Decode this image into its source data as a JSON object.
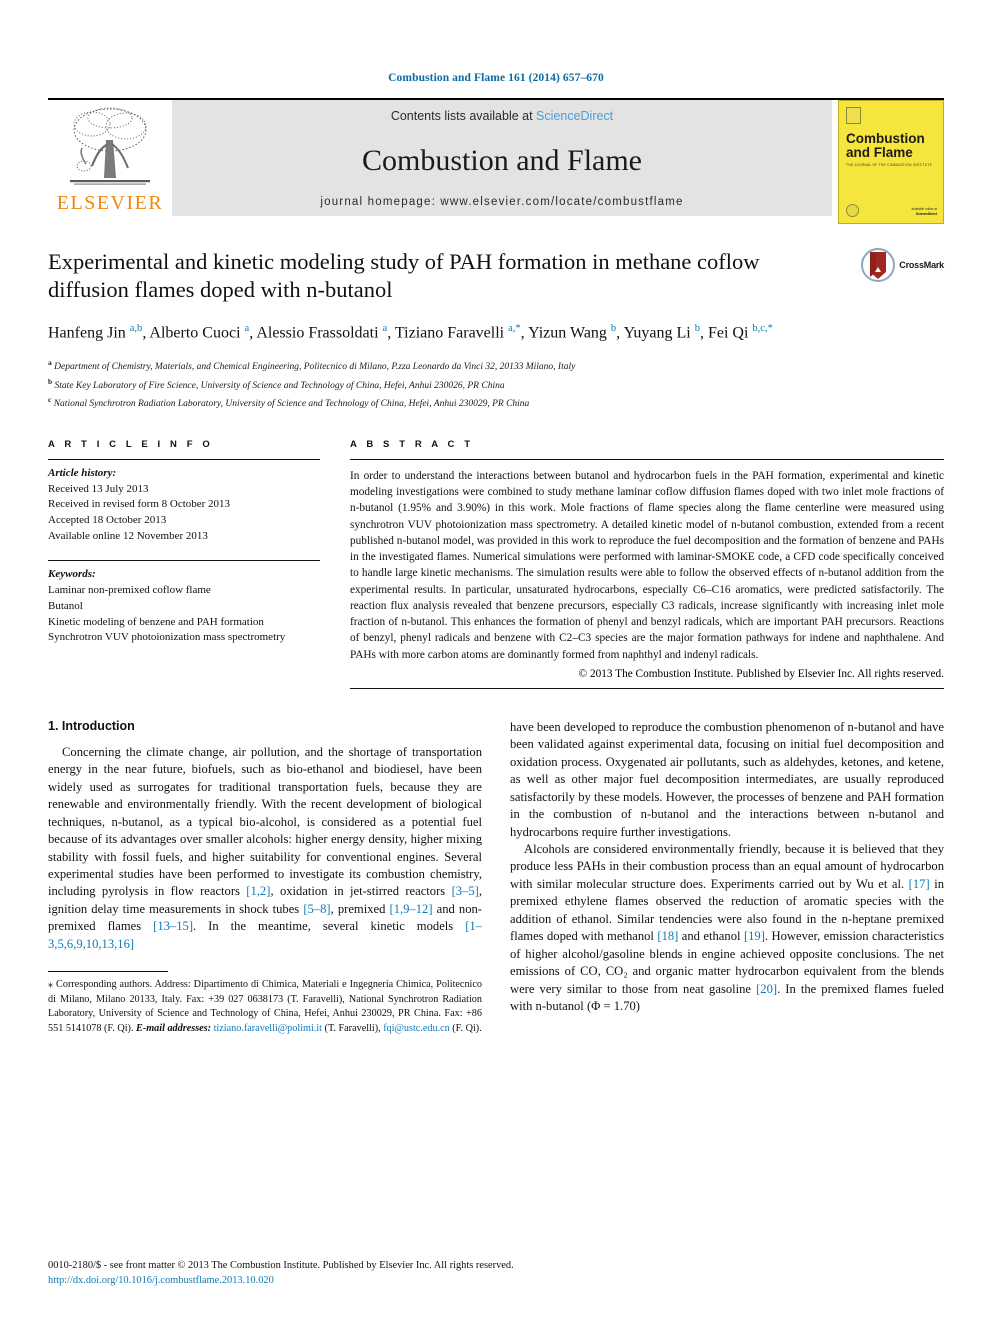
{
  "running_head": "Combustion and Flame 161 (2014) 657–670",
  "masthead": {
    "publisher_logo_label": "ELSEVIER",
    "contents_prefix": "Contents lists available at ",
    "contents_link": "ScienceDirect",
    "journal_title": "Combustion and Flame",
    "homepage_label": "journal homepage: www.elsevier.com/locate/combustflame",
    "cover": {
      "title_line1": "Combustion",
      "title_line2": "and Flame",
      "subtitle": "THE JOURNAL OF THE COMBUSTION INSTITUTE",
      "footer_line1": "available online at",
      "footer_line2": "ScienceDirect"
    },
    "cover_color": "#f5e53c",
    "link_color": "#4a9fd4",
    "band_color": "#e3e3e3"
  },
  "article": {
    "title": "Experimental and kinetic modeling study of PAH formation in methane coflow diffusion flames doped with n-butanol",
    "crossmark_label": "CrossMark",
    "authors_html": "Hanfeng Jin <sup>a,b</sup>, Alberto Cuoci <sup>a</sup>, Alessio Frassoldati <sup>a</sup>, Tiziano Faravelli <sup>a,*</sup>, Yizun Wang <sup>b</sup>, Yuyang Li <sup>b</sup>, Fei Qi <sup>b,c,*</sup>",
    "affiliations": [
      "Department of Chemistry, Materials, and Chemical Engineering, Politecnico di Milano, P.zza Leonardo da Vinci 32, 20133 Milano, Italy",
      "State Key Laboratory of Fire Science, University of Science and Technology of China, Hefei, Anhui 230026, PR China",
      "National Synchrotron Radiation Laboratory, University of Science and Technology of China, Hefei, Anhui 230029, PR China"
    ],
    "affiliation_marks": [
      "a",
      "b",
      "c"
    ]
  },
  "article_info": {
    "heading": "A R T I C L E   I N F O",
    "history_label": "Article history:",
    "history": [
      "Received 13 July 2013",
      "Received in revised form 8 October 2013",
      "Accepted 18 October 2013",
      "Available online 12 November 2013"
    ],
    "keywords_label": "Keywords:",
    "keywords": [
      "Laminar non-premixed coflow flame",
      "Butanol",
      "Kinetic modeling of benzene and PAH formation",
      "Synchrotron VUV photoionization mass spectrometry"
    ]
  },
  "abstract": {
    "heading": "A B S T R A C T",
    "text": "In order to understand the interactions between butanol and hydrocarbon fuels in the PAH formation, experimental and kinetic modeling investigations were combined to study methane laminar coflow diffusion flames doped with two inlet mole fractions of n-butanol (1.95% and 3.90%) in this work. Mole fractions of flame species along the flame centerline were measured using synchrotron VUV photoionization mass spectrometry. A detailed kinetic model of n-butanol combustion, extended from a recent published n-butanol model, was provided in this work to reproduce the fuel decomposition and the formation of benzene and PAHs in the investigated flames. Numerical simulations were performed with laminar-SMOKE code, a CFD code specifically conceived to handle large kinetic mechanisms. The simulation results were able to follow the observed effects of n-butanol addition from the experimental results. In particular, unsaturated hydrocarbons, especially C6–C16 aromatics, were predicted satisfactorily. The reaction flux analysis revealed that benzene precursors, especially C3 radicals, increase significantly with increasing inlet mole fraction of n-butanol. This enhances the formation of phenyl and benzyl radicals, which are important PAH precursors. Reactions of benzyl, phenyl radicals and benzene with C2–C3 species are the major formation pathways for indene and naphthalene. And PAHs with more carbon atoms are dominantly formed from naphthyl and indenyl radicals.",
    "copyright": "© 2013 The Combustion Institute. Published by Elsevier Inc. All rights reserved."
  },
  "body": {
    "section_title": "1. Introduction",
    "left_paragraphs": [
      "Concerning the climate change, air pollution, and the shortage of transportation energy in the near future, biofuels, such as bio-ethanol and biodiesel, have been widely used as surrogates for traditional transportation fuels, because they are renewable and environmentally friendly. With the recent development of biological techniques, n-butanol, as a typical bio-alcohol, is considered as a potential fuel because of its advantages over smaller alcohols: higher energy density, higher mixing stability with fossil fuels, and higher suitability for conventional engines. Several experimental studies have been performed to investigate its combustion chemistry, including pyrolysis in flow reactors [1,2], oxidation in jet-stirred reactors [3–5], ignition delay time measurements in shock tubes [5–8], premixed [1,9–12] and non-premixed flames [13–15]. In the meantime, several kinetic models [1–3,5,6,9,10,13,16]"
    ],
    "right_paragraphs": [
      "have been developed to reproduce the combustion phenomenon of n-butanol and have been validated against experimental data, focusing on initial fuel decomposition and oxidation process. Oxygenated air pollutants, such as aldehydes, ketones, and ketene, as well as other major fuel decomposition intermediates, are usually reproduced satisfactorily by these models. However, the processes of benzene and PAH formation in the combustion of n-butanol and the interactions between n-butanol and hydrocarbons require further investigations.",
      "Alcohols are considered environmentally friendly, because it is believed that they produce less PAHs in their combustion process than an equal amount of hydrocarbon with similar molecular structure does. Experiments carried out by Wu et al. [17] in premixed ethylene flames observed the reduction of aromatic species with the addition of ethanol. Similar tendencies were also found in the n-heptane premixed flames doped with methanol [18] and ethanol [19]. However, emission characteristics of higher alcohol/gasoline blends in engine achieved opposite conclusions. The net emissions of CO, CO₂ and organic matter hydrocarbon equivalent from the blends were very similar to those from neat gasoline [20]. In the premixed flames fueled with n-butanol (Φ = 1.70)"
    ]
  },
  "footnote": {
    "marker": "⁎",
    "text": "Corresponding authors. Address: Dipartimento di Chimica, Materiali e Ingegneria Chimica, Politecnico di Milano, Milano 20133, Italy. Fax: +39 027 0638173 (T. Faravelli), National Synchrotron Radiation Laboratory, University of Science and Technology of China, Hefei, Anhui 230029, PR China. Fax: +86 551 5141078 (F. Qi).",
    "email_label": "E-mail addresses:",
    "email1": "tiziano.faravelli@polimi.it",
    "email1_owner": "(T. Faravelli),",
    "email2": "fqi@ustc.edu.cn",
    "email2_owner": "(F. Qi)."
  },
  "page_footer": {
    "line1": "0010-2180/$ - see front matter © 2013 The Combustion Institute. Published by Elsevier Inc. All rights reserved.",
    "doi": "http://dx.doi.org/10.1016/j.combustflame.2013.10.020"
  }
}
